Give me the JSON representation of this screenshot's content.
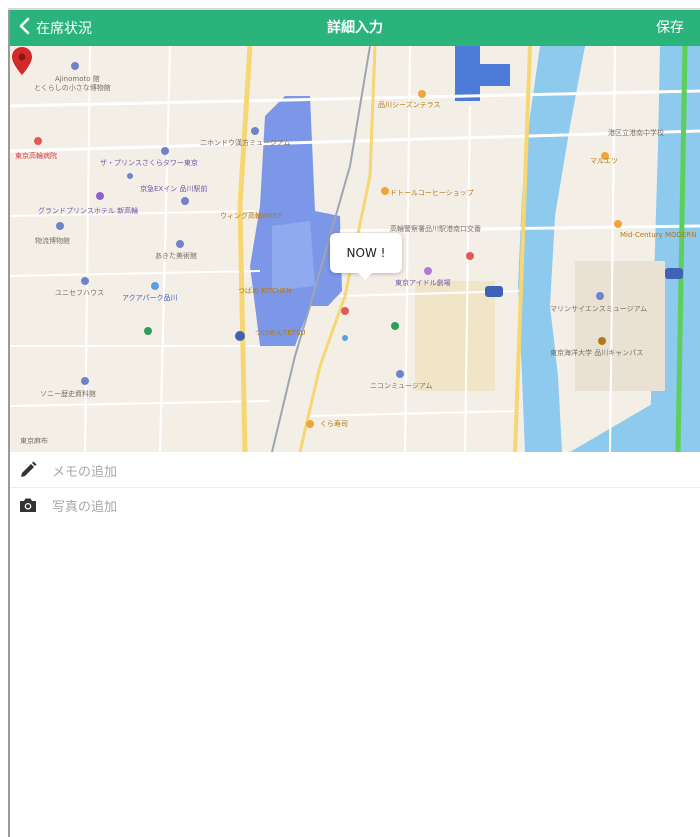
{
  "navbar": {
    "back_label": "在席状況",
    "title": "詳細入力",
    "save_label": "保存",
    "background": "#2bb37c"
  },
  "map": {
    "marker_label": "NOW !",
    "pin_color": "#d22a2a",
    "labels": [
      "Ajinomoto 館",
      "とくらしの小さな博物館",
      "品川シーズンテラス",
      "二ホンドウ漢方ミュージアム",
      "港区立港南中学校",
      "東京高輪病院",
      "ザ・プリンスさくらタワー東京",
      "マルエツ",
      "京急EXイン 品川駅前",
      "グランドプリンスホテル 新高輪",
      "ウィング高輪WEST",
      "ドトールコーヒーショップ",
      "高輪警察署品川駅港南口交番",
      "物流博物館",
      "あきた美術館",
      "Mid-Century MODERN",
      "東京アイドル劇場",
      "ユニセフハウス",
      "アクアパーク品川",
      "つばめ KITCHEN",
      "マリンサイエンスミュージアム",
      "つけめんTETSU",
      "東京海洋大学 品川キャンパス",
      "ソニー歴史資料館",
      "ニコンミュージアム",
      "くら寿司",
      "東京麻布"
    ]
  },
  "rows": {
    "memo_label": "メモの追加",
    "photo_label": "写真の追加"
  },
  "icons": [
    "chevron-left-icon",
    "pencil-icon",
    "camera-icon",
    "map-pin-icon"
  ]
}
